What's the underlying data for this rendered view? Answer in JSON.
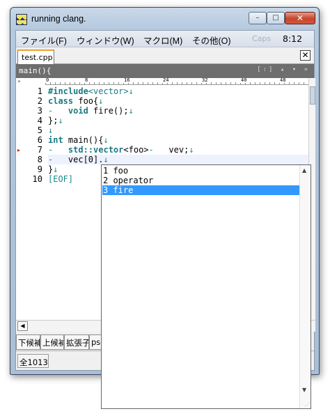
{
  "window": {
    "title": "running clang.",
    "min_icon": "–",
    "max_icon": "□",
    "close_icon": "✕"
  },
  "menu": {
    "items": [
      "ファイル(F)",
      "ウィンドウ(W)",
      "マクロ(M)",
      "その他(O)"
    ],
    "caps": "Caps",
    "clock": "8:12"
  },
  "tabs": {
    "active": "test.cpp",
    "close_icon": "✕"
  },
  "funcbar": {
    "text": "main(){",
    "controls": "[:] ▴ ▾ »"
  },
  "ruler": {
    "corner": "»",
    "labels": [
      "0",
      "8",
      "16",
      "24",
      "32",
      "40",
      "48"
    ]
  },
  "editor": {
    "line_numbers": [
      "1",
      "2",
      "3",
      "4",
      "5",
      "6",
      "7",
      "8",
      "9",
      "10"
    ],
    "lines": [
      [
        {
          "t": "#include",
          "c": "kw"
        },
        {
          "t": "<vector>",
          "c": "kw2"
        },
        {
          "t": "↓",
          "c": "mk"
        }
      ],
      [
        {
          "t": "class",
          "c": "kw"
        },
        {
          "t": " foo{",
          "c": ""
        },
        {
          "t": "↓",
          "c": "mk"
        }
      ],
      [
        {
          "t": "-   ",
          "c": "mk"
        },
        {
          "t": "void",
          "c": "kw"
        },
        {
          "t": " fire();",
          "c": ""
        },
        {
          "t": "↓",
          "c": "mk"
        }
      ],
      [
        {
          "t": "};",
          "c": ""
        },
        {
          "t": "↓",
          "c": "mk"
        }
      ],
      [
        {
          "t": "↓",
          "c": "mk"
        }
      ],
      [
        {
          "t": "int",
          "c": "kw"
        },
        {
          "t": " main(){",
          "c": ""
        },
        {
          "t": "↓",
          "c": "mk"
        }
      ],
      [
        {
          "t": "-   ",
          "c": "mk"
        },
        {
          "t": "std::vector",
          "c": "kw"
        },
        {
          "t": "<foo>",
          "c": ""
        },
        {
          "t": "-   ",
          "c": "mk"
        },
        {
          "t": "vev;",
          "c": ""
        },
        {
          "t": "↓",
          "c": "mk"
        }
      ],
      [
        {
          "t": "-   ",
          "c": "mk"
        },
        {
          "t": "vec[0].",
          "c": ""
        },
        {
          "t": "↓",
          "c": "mk"
        }
      ],
      [
        {
          "t": "}",
          "c": ""
        },
        {
          "t": "↓",
          "c": "mk"
        }
      ],
      [
        {
          "t": "[EOF]",
          "c": "eof"
        }
      ]
    ],
    "marker_line": "7",
    "marker_icon": "▸"
  },
  "scroll": {
    "left_arrow": "◀"
  },
  "bottom_tabs": [
    "下候補",
    "上候補",
    "拡張子",
    "pse"
  ],
  "status": {
    "cell": "全1013"
  },
  "completion": {
    "items": [
      "1 foo",
      "2 operator",
      "3 fire"
    ],
    "selected_index": 2,
    "up_arrow": "▲",
    "down_arrow": "▼",
    "grip": "⋰"
  },
  "colors": {
    "selection": "#3399ff",
    "keyword": "#1a7a82",
    "marker": "#d02020"
  }
}
